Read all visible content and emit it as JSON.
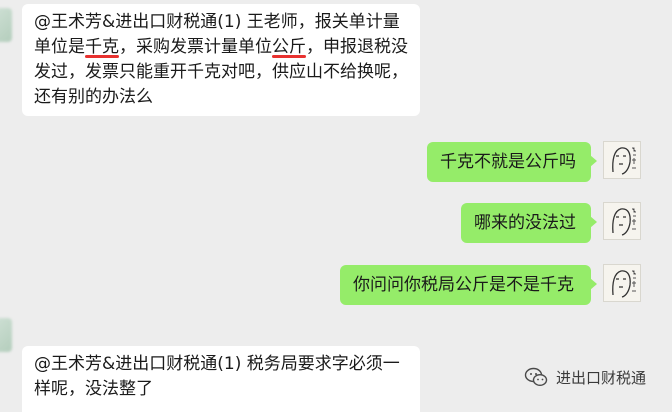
{
  "messages": [
    {
      "side": "left",
      "segments": [
        {
          "text": "@王术芳&进出口财税通(1) 王老师，报关单计量",
          "u": false
        },
        {
          "text": "单位是",
          "u": false
        },
        {
          "text": "千克",
          "u": true
        },
        {
          "text": "，采购发票计量单位",
          "u": false
        },
        {
          "text": "公斤",
          "u": true
        },
        {
          "text": "，申报退税没发过，发票只能重开千克对吧，供应山不给换呢，还有别的办法么",
          "u": false
        }
      ]
    },
    {
      "side": "right",
      "text": "千克不就是公斤吗"
    },
    {
      "side": "right",
      "text": "哪来的没法过"
    },
    {
      "side": "right",
      "text": "你问问你税局公斤是不是千克"
    },
    {
      "side": "left",
      "segments": [
        {
          "text": "@王术芳&进出口财税通(1) 税务局",
          "u": false
        },
        {
          "text": "要求字必须一样呢",
          "u": true
        },
        {
          "text": "，没法整了",
          "u": false
        }
      ]
    }
  ],
  "watermark": {
    "text": "进出口财税通",
    "icon": "wechat-official-account-icon"
  },
  "colors": {
    "background": "#ededed",
    "green_bubble": "#95ec69",
    "white_bubble": "#ffffff",
    "underline": "#e8312f"
  }
}
